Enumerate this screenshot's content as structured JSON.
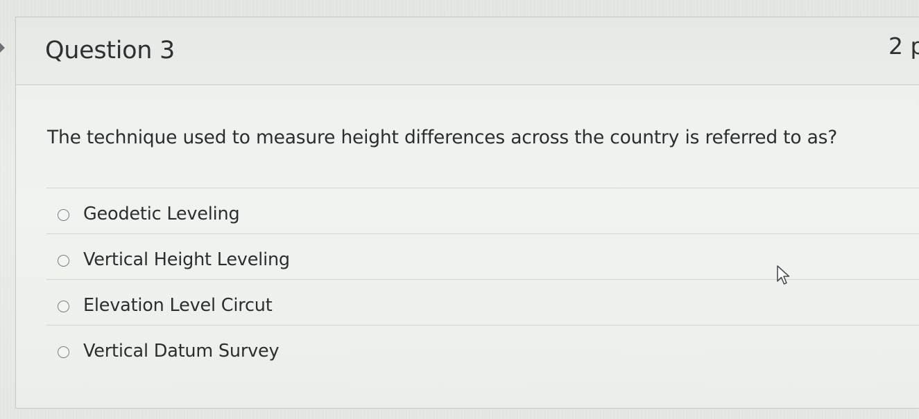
{
  "question": {
    "title": "Question 3",
    "points": "2 p",
    "text": "The technique used to measure height differences across the country is referred to as?"
  },
  "answers": [
    {
      "label": "Geodetic Leveling",
      "selected": false
    },
    {
      "label": "Vertical Height Leveling",
      "selected": false
    },
    {
      "label": "Elevation Level Circut",
      "selected": false
    },
    {
      "label": "Vertical Datum Survey",
      "selected": false
    }
  ],
  "icons": {
    "radio": "radio-unselected-icon",
    "cursor": "mouse-pointer-icon",
    "marker": "caret-right-icon"
  },
  "colors": {
    "text": "#2b2d2e",
    "border": "#c4c7c4",
    "background": "#eceeeb"
  }
}
